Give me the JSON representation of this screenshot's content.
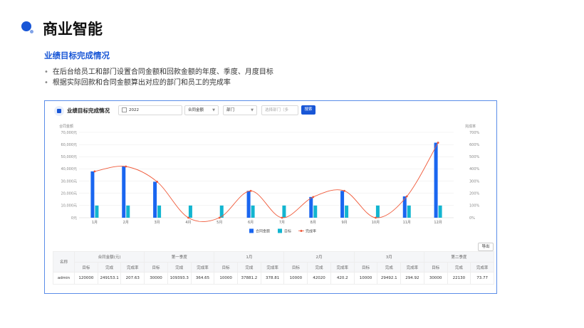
{
  "page": {
    "title": "商业智能",
    "subtitle": "业绩目标完成情况",
    "bullets": [
      "在后台给员工和部门设置合同金额和回款金额的年度、季度、月度目标",
      "根据实际回款和合同金额算出对应的部门和员工的完成率"
    ]
  },
  "panel": {
    "title": "业绩目标完成情况",
    "filters": {
      "year": "2022",
      "amount_type": "合同金额",
      "dimension": "部门",
      "department_placeholder": "选择部门（多",
      "search_label": "搜索"
    },
    "export_label": "导出"
  },
  "chart_data": {
    "type": "bar",
    "categories": [
      "1月",
      "2月",
      "3月",
      "4月",
      "5月",
      "6月",
      "7月",
      "8月",
      "9月",
      "10月",
      "11月",
      "12月"
    ],
    "series": [
      {
        "name": "合同金额",
        "kind": "bar",
        "axis": "left",
        "color": "#1a66f0",
        "values": [
          38000,
          42000,
          29500,
          0,
          0,
          22000,
          0,
          17000,
          22000,
          0,
          17500,
          61500
        ]
      },
      {
        "name": "目标",
        "kind": "bar",
        "axis": "left",
        "color": "#12b5d0",
        "values": [
          10000,
          10000,
          10000,
          10000,
          10000,
          10000,
          10000,
          10000,
          10000,
          10000,
          10000,
          10000
        ]
      },
      {
        "name": "完成率",
        "kind": "line",
        "axis": "right",
        "color": "#f05a3a",
        "values": [
          380,
          420,
          295,
          0,
          0,
          220,
          0,
          170,
          220,
          0,
          175,
          615
        ]
      }
    ],
    "y_left": {
      "label": "合同金额",
      "min": 0,
      "max": 70000,
      "ticks": [
        "0元",
        "10,000元",
        "20,000元",
        "30,000元",
        "40,000元",
        "50,000元",
        "60,000元",
        "70,000元"
      ]
    },
    "y_right": {
      "label": "完成率",
      "min": 0,
      "max": 700,
      "ticks": [
        "0%",
        "100%",
        "200%",
        "300%",
        "400%",
        "500%",
        "600%",
        "700%"
      ]
    },
    "grid": true,
    "legend_position": "bottom"
  },
  "table": {
    "name_header": "名称",
    "groups": [
      "合同金额(元)",
      "第一季度",
      "1月",
      "2月",
      "3月",
      "第二季度"
    ],
    "subheaders": [
      "目标",
      "完成",
      "完成率"
    ],
    "rows": [
      {
        "name": "admin",
        "cells": [
          "120000",
          "249153.1",
          "207.63",
          "30000",
          "109393.3",
          "364.65",
          "10000",
          "37881.2",
          "378.81",
          "10000",
          "42020",
          "420.2",
          "10000",
          "29492.1",
          "294.92",
          "30000",
          "22130",
          "73.77"
        ]
      }
    ]
  }
}
